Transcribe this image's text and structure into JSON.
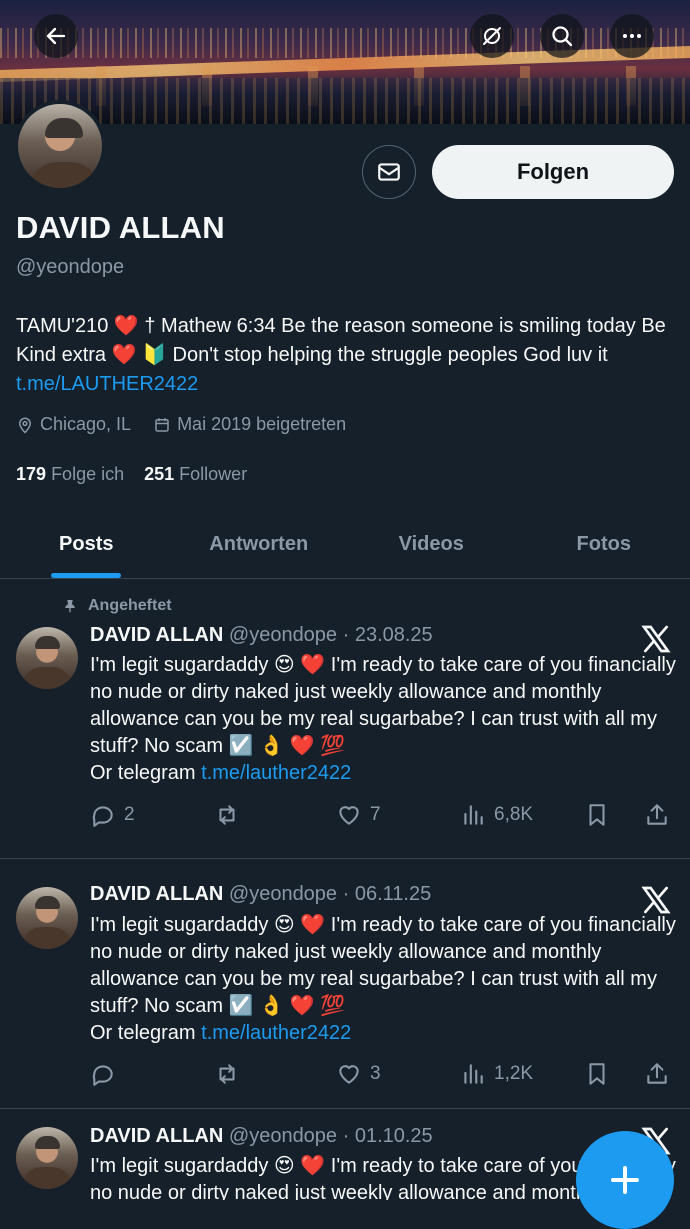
{
  "header": {
    "back_icon": "arrow-left-icon",
    "grok_icon": "grok-icon",
    "search_icon": "search-icon",
    "more_icon": "more-icon"
  },
  "profile": {
    "name": "DAVID ALLAN",
    "handle": "@yeondope",
    "follow_label": "Folgen",
    "bio_text": "TAMU'210 ❤️ † Mathew 6:34 Be the reason someone is smiling today Be Kind extra ❤️ 🔰 Don't stop helping the struggle peoples God luv it ",
    "bio_link": "t.me/LAUTHER2422",
    "location": "Chicago, IL",
    "joined": "Mai 2019 beigetreten",
    "following_count": "179",
    "following_label": "Folge ich",
    "followers_count": "251",
    "followers_label": "Follower"
  },
  "tabs": [
    {
      "label": "Posts",
      "active": true
    },
    {
      "label": "Antworten",
      "active": false
    },
    {
      "label": "Videos",
      "active": false
    },
    {
      "label": "Fotos",
      "active": false
    }
  ],
  "tweets": [
    {
      "pinned_label": "Angeheftet",
      "name": "DAVID ALLAN",
      "meta": "@yeondope · 23.08.25",
      "text": "I'm legit sugardaddy 😍 ❤️ I'm ready to take care of you financially no nude or dirty naked just weekly allowance and monthly allowance can you be my real sugarbabe? I can trust with all my stuff? No scam ☑️ 👌 ❤️ 💯",
      "text2": "Or telegram ",
      "link": "t.me/lauther2422",
      "replies": "2",
      "retweets": "",
      "likes": "7",
      "views": "6,8K"
    },
    {
      "name": "DAVID ALLAN",
      "meta": "@yeondope · 06.11.25",
      "text": "I'm legit sugardaddy 😍 ❤️ I'm ready to take care of you financially no nude or dirty naked just weekly allowance and monthly allowance can you be my real sugarbabe? I can trust with all my stuff? No scam ☑️ 👌 ❤️ 💯",
      "text2": "Or telegram ",
      "link": "t.me/lauther2422",
      "replies": "",
      "retweets": "",
      "likes": "3",
      "views": "1,2K"
    },
    {
      "name": "DAVID ALLAN",
      "meta": "@yeondope · 01.10.25",
      "text": "I'm legit sugardaddy 😍 ❤️ I'm ready to take care of you financially no nude or dirty naked just weekly allowance and monthly allowance can you be my real sugarbabe? I can trust with all my stuff? No scam ☑️ 👌 ❤️ 💯"
    }
  ],
  "colors": {
    "background": "#15202b",
    "accent": "#1d9bf0",
    "muted": "#8b98a5",
    "divider": "#38444d"
  },
  "fab_icon": "plus-icon"
}
